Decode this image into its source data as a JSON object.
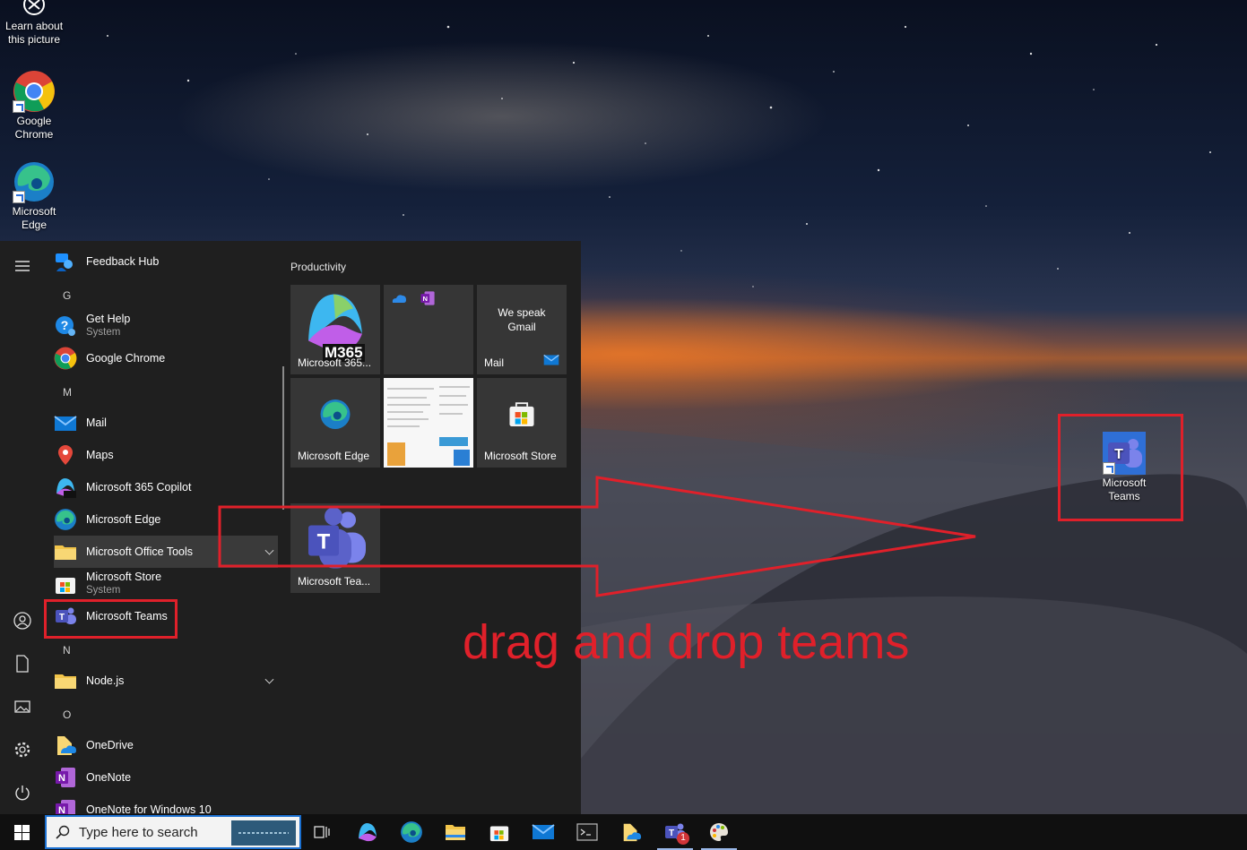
{
  "desktop": {
    "icons": [
      {
        "label_1": "Learn about",
        "label_2": "this picture"
      },
      {
        "label_1": "Google",
        "label_2": "Chrome"
      },
      {
        "label_1": "Microsoft",
        "label_2": "Edge"
      },
      {
        "label_1": "Microsoft",
        "label_2": "Teams"
      }
    ]
  },
  "start_menu": {
    "apps": [
      {
        "name": "Feedback Hub"
      },
      {
        "letter": "G"
      },
      {
        "name": "Get Help",
        "sub": "System"
      },
      {
        "name": "Google Chrome"
      },
      {
        "letter": "M"
      },
      {
        "name": "Mail"
      },
      {
        "name": "Maps"
      },
      {
        "name": "Microsoft 365 Copilot"
      },
      {
        "name": "Microsoft Edge"
      },
      {
        "name": "Microsoft Office Tools"
      },
      {
        "name": "Microsoft Store",
        "sub": "System"
      },
      {
        "name": "Microsoft Teams"
      },
      {
        "letter": "N"
      },
      {
        "name": "Node.js"
      },
      {
        "letter": "O"
      },
      {
        "name": "OneDrive"
      },
      {
        "name": "OneNote"
      },
      {
        "name": "OneNote for Windows 10"
      }
    ],
    "tiles_group": "Productivity",
    "tiles": {
      "m365": {
        "label": "Microsoft 365...",
        "badge": "M365"
      },
      "mail": {
        "label": "Mail",
        "line1": "We speak",
        "line2": "Gmail"
      },
      "edge": {
        "label": "Microsoft Edge"
      },
      "store": {
        "label": "Microsoft Store"
      },
      "teams": {
        "label": "Microsoft Tea..."
      }
    }
  },
  "annotation": {
    "text": "drag and drop teams",
    "color": "#e0202a"
  },
  "taskbar": {
    "search_placeholder": "Type here to search",
    "teams_badge": "1"
  }
}
